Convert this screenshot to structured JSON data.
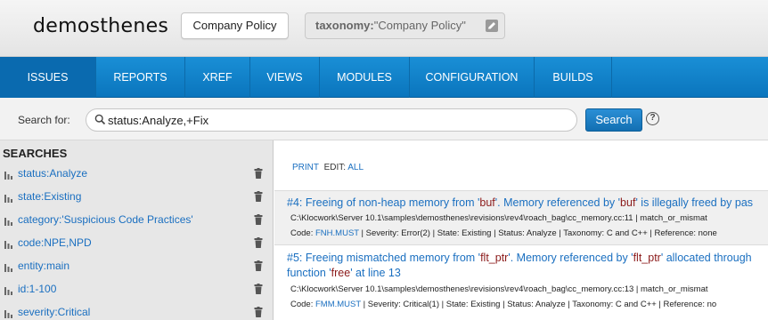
{
  "header": {
    "project": "demosthenes",
    "policy_button": "Company Policy",
    "taxonomy_key": "taxonomy:",
    "taxonomy_value": "\"Company Policy\""
  },
  "nav": {
    "items": [
      "ISSUES",
      "REPORTS",
      "XREF",
      "VIEWS",
      "MODULES",
      "CONFIGURATION",
      "BUILDS"
    ],
    "active": "ISSUES"
  },
  "search": {
    "label": "Search for:",
    "value": "status:Analyze,+Fix",
    "button": "Search",
    "help": "?"
  },
  "sidebar": {
    "title": "SEARCHES",
    "items": [
      {
        "label": "status:Analyze"
      },
      {
        "label": "state:Existing"
      },
      {
        "label": "category:'Suspicious Code Practices'"
      },
      {
        "label": "code:NPE,NPD"
      },
      {
        "label": "entity:main"
      },
      {
        "label": "id:1-100"
      },
      {
        "label": "severity:Critical"
      }
    ]
  },
  "actions": {
    "print": "PRINT",
    "edit_label": "EDIT:",
    "all": "ALL"
  },
  "issues": [
    {
      "id": "#4:",
      "title_pre": "Freeing of non-heap memory from '",
      "var1": "buf",
      "title_mid": "'. Memory referenced by '",
      "var2": "buf",
      "title_post": "' is illegally freed by pas",
      "path": "C:\\Klocwork\\Server 10.1\\samples\\demosthenes\\revisions\\rev4\\roach_bag\\cc_memory.cc:11 | match_or_mismat",
      "code_label": "Code:",
      "code": "FNH.MUST",
      "meta": " | Severity: Error(2) | State: Existing | Status: Analyze | Taxonomy: C and C++ | Reference: none"
    },
    {
      "id": "#5:",
      "title_pre": "Freeing mismatched memory from '",
      "var1": "flt_ptr",
      "title_mid": "'. Memory referenced by '",
      "var2": "flt_ptr",
      "title_post": "' allocated through",
      "title_line2_pre": "function '",
      "var3": "free",
      "title_line2_post": "' at line 13",
      "path": "C:\\Klocwork\\Server 10.1\\samples\\demosthenes\\revisions\\rev4\\roach_bag\\cc_memory.cc:13 | match_or_mismat",
      "code_label": "Code:",
      "code": "FMM.MUST",
      "meta": " | Severity: Critical(1) | State: Existing | Status: Analyze | Taxonomy: C and C++ | Reference: no"
    }
  ]
}
